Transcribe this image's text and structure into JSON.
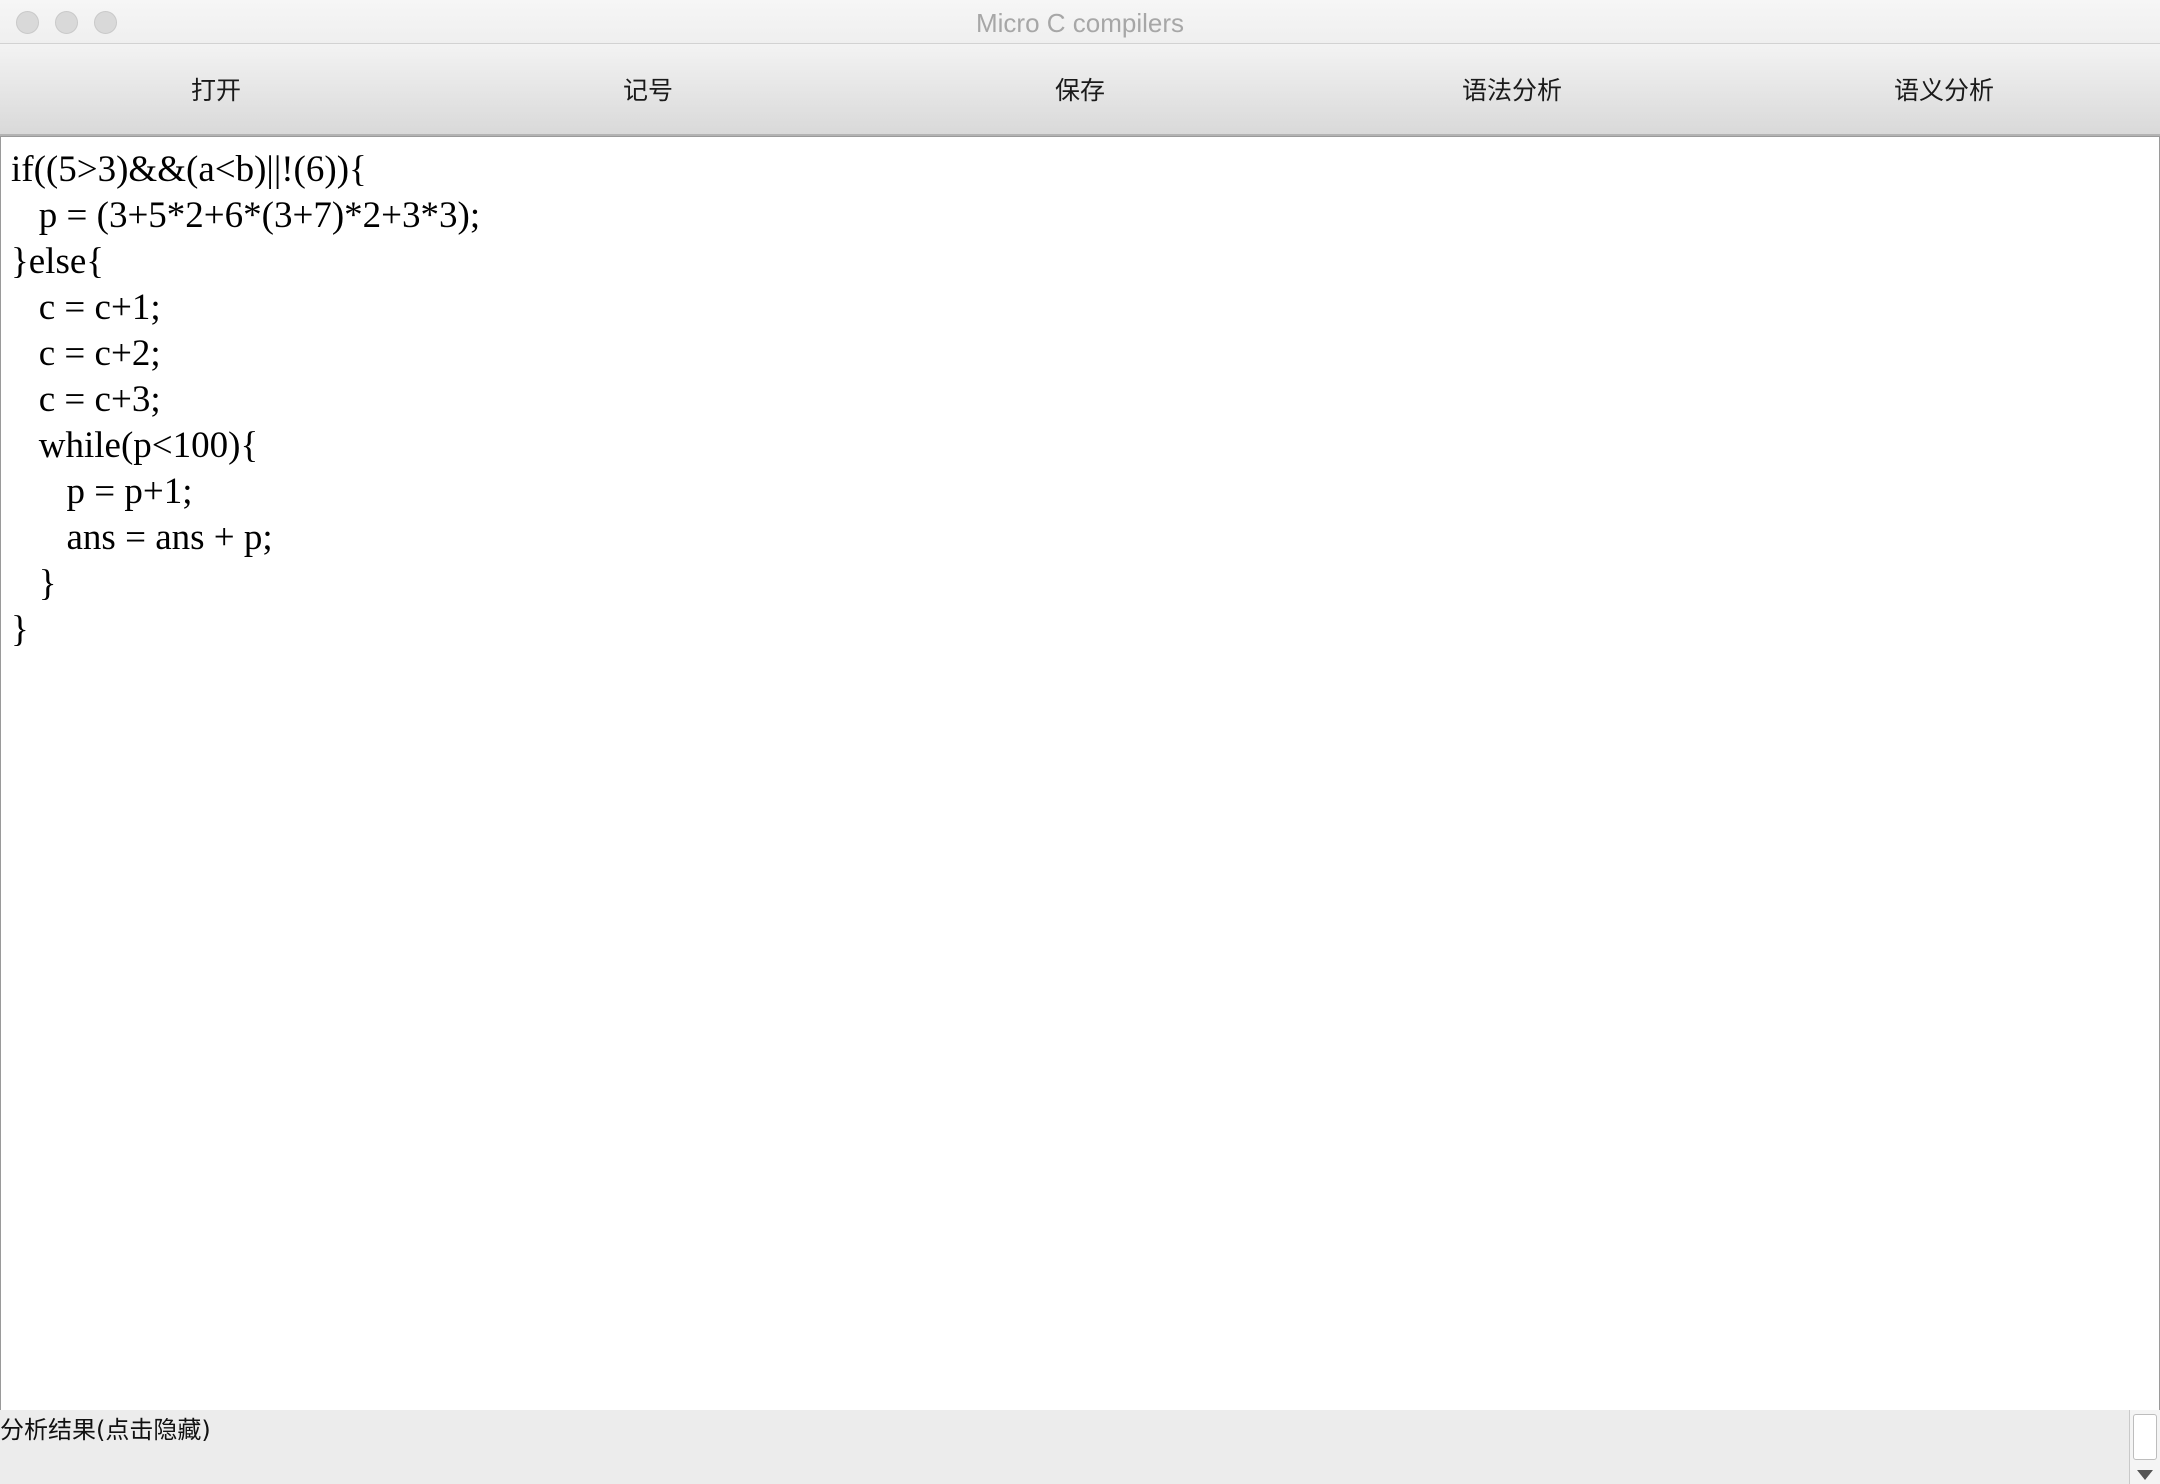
{
  "window": {
    "title": "Micro C compilers"
  },
  "toolbar": {
    "buttons": [
      {
        "label": "打开"
      },
      {
        "label": "记号"
      },
      {
        "label": "保存"
      },
      {
        "label": "语法分析"
      },
      {
        "label": "语义分析"
      }
    ]
  },
  "editor": {
    "code": "if((5>3)&&(a<b)||!(6)){\n   p = (3+5*2+6*(3+7)*2+3*3);\n}else{\n   c = c+1;\n   c = c+2;\n   c = c+3;\n   while(p<100){\n      p = p+1;\n      ans = ans + p;\n   }\n}"
  },
  "result_panel": {
    "label": "分析结果(点击隐藏)",
    "content": ""
  }
}
